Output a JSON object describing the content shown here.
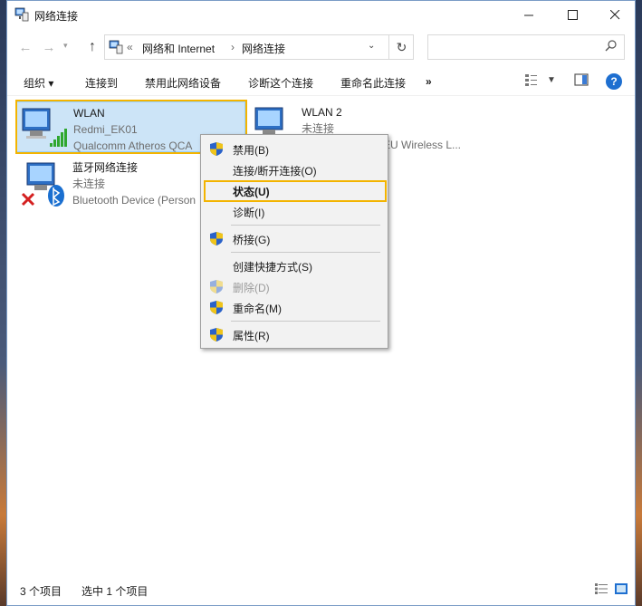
{
  "window": {
    "title": "网络连接"
  },
  "nav": {
    "back_glyph": "←",
    "forward_glyph": "→",
    "up_glyph": "↑",
    "breadcrumb_sep": "«",
    "crumb1": "网络和 Internet",
    "crumb_arrow": "›",
    "crumb2": "网络连接",
    "search_placeholder": ""
  },
  "toolbar": {
    "organize": "组织 ▾",
    "connect_to": "连接到",
    "disable_device": "禁用此网络设备",
    "diagnose": "诊断这个连接",
    "rename": "重命名此连接",
    "more": "»"
  },
  "items": [
    {
      "name": "WLAN",
      "line1": "Redmi_EK01",
      "line2": "Qualcomm Atheros QCA"
    },
    {
      "name": "WLAN 2",
      "line1": "未连接",
      "line2": "EU Wireless L..."
    },
    {
      "name": "蓝牙网络连接",
      "line1": "未连接",
      "line2": "Bluetooth Device (Person"
    }
  ],
  "context_menu": {
    "disable": "禁用(B)",
    "connect_disconnect": "连接/断开连接(O)",
    "status": "状态(U)",
    "diagnose": "诊断(I)",
    "bridge": "桥接(G)",
    "create_shortcut": "创建快捷方式(S)",
    "delete": "删除(D)",
    "rename": "重命名(M)",
    "properties": "属性(R)"
  },
  "statusbar": {
    "count": "3 个项目",
    "selected": "选中 1 个项目"
  },
  "colors": {
    "accent": "#f3b400",
    "selection": "#cce4f7",
    "help": "#1e6fd0"
  }
}
